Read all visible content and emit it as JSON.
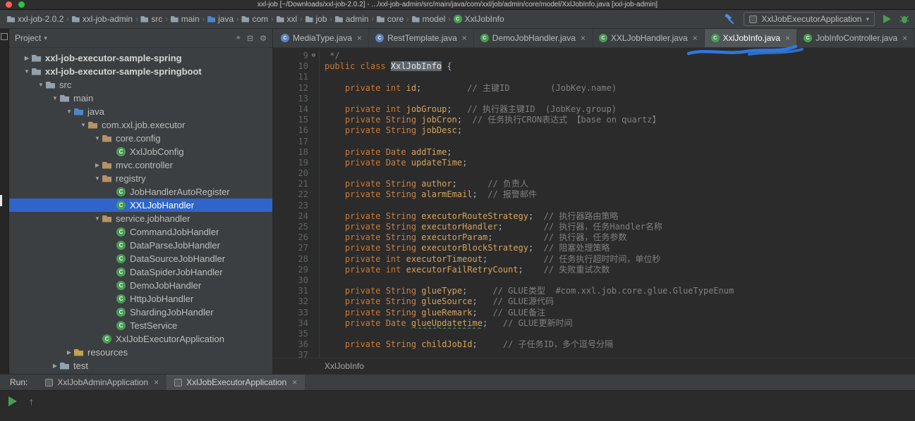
{
  "ui": {
    "chevron": "›",
    "caret": "▾",
    "close": "×",
    "fold": "⊖",
    "arrow_open": "▼",
    "arrow_closed": "▶",
    "up_arrow": "↑"
  },
  "colors": {
    "selection_blue": "#2f65ca",
    "annotation_blue": "#2f7ef0",
    "run_green": "#499C54",
    "keyword_orange": "#cc7832"
  },
  "title_bar": {
    "title": "xxl-job [~/Downloads/xxl-job-2.0.2] - .../xxl-job-admin/src/main/java/com/xxl/job/admin/core/model/XxlJobInfo.java [xxl-job-admin]",
    "lights": [
      {
        "name": "close",
        "color": "#ff5f57"
      },
      {
        "name": "zoom",
        "color": "#28c840"
      }
    ]
  },
  "navbar": {
    "breadcrumbs": [
      {
        "label": "xxl-job-2.0.2",
        "icon": "module"
      },
      {
        "label": "xxl-job-admin",
        "icon": "module"
      },
      {
        "label": "src",
        "icon": "folder"
      },
      {
        "label": "main",
        "icon": "folder"
      },
      {
        "label": "java",
        "icon": "src"
      },
      {
        "label": "com",
        "icon": "folder"
      },
      {
        "label": "xxl",
        "icon": "folder"
      },
      {
        "label": "job",
        "icon": "folder"
      },
      {
        "label": "admin",
        "icon": "folder"
      },
      {
        "label": "core",
        "icon": "folder"
      },
      {
        "label": "model",
        "icon": "folder"
      },
      {
        "label": "XxlJobInfo",
        "icon": "class"
      }
    ],
    "run_config": {
      "label": "XxlJobExecutorApplication"
    }
  },
  "project_panel": {
    "title": "Project",
    "toolbar_icons": [
      {
        "name": "locate-icon",
        "glyph": "⌖"
      },
      {
        "name": "collapse-all-icon",
        "glyph": "⊟"
      },
      {
        "name": "settings-gear-icon",
        "glyph": "⚙"
      }
    ],
    "items": [
      {
        "label": "xxl-job-executor-sample-spring",
        "depth": 0,
        "arrow": "closed",
        "icon": "module",
        "bold": true
      },
      {
        "label": "xxl-job-executor-sample-springboot",
        "depth": 0,
        "arrow": "open",
        "icon": "module",
        "bold": true
      },
      {
        "label": "src",
        "depth": 1,
        "arrow": "open",
        "icon": "folder"
      },
      {
        "label": "main",
        "depth": 2,
        "arrow": "open",
        "icon": "folder"
      },
      {
        "label": "java",
        "depth": 3,
        "arrow": "open",
        "icon": "src"
      },
      {
        "label": "com.xxl.job.executor",
        "depth": 4,
        "arrow": "open",
        "icon": "pkg"
      },
      {
        "label": "core.config",
        "depth": 5,
        "arrow": "open",
        "icon": "pkg"
      },
      {
        "label": "XxlJobConfig",
        "depth": 6,
        "arrow": "none",
        "icon": "class"
      },
      {
        "label": "mvc.controller",
        "depth": 5,
        "arrow": "closed",
        "icon": "pkg"
      },
      {
        "label": "registry",
        "depth": 5,
        "arrow": "open",
        "icon": "pkg"
      },
      {
        "label": "JobHandlerAutoRegister",
        "depth": 6,
        "arrow": "none",
        "icon": "class"
      },
      {
        "label": "XXLJobHandler",
        "depth": 6,
        "arrow": "none",
        "icon": "class",
        "selected": true
      },
      {
        "label": "service.jobhandler",
        "depth": 5,
        "arrow": "open",
        "icon": "pkg"
      },
      {
        "label": "CommandJobHandler",
        "depth": 6,
        "arrow": "none",
        "icon": "class"
      },
      {
        "label": "DataParseJobHandler",
        "depth": 6,
        "arrow": "none",
        "icon": "class"
      },
      {
        "label": "DataSourceJobHandler",
        "depth": 6,
        "arrow": "none",
        "icon": "class"
      },
      {
        "label": "DataSpiderJobHandler",
        "depth": 6,
        "arrow": "none",
        "icon": "class"
      },
      {
        "label": "DemoJobHandler",
        "depth": 6,
        "arrow": "none",
        "icon": "class"
      },
      {
        "label": "HttpJobHandler",
        "depth": 6,
        "arrow": "none",
        "icon": "class"
      },
      {
        "label": "ShardingJobHandler",
        "depth": 6,
        "arrow": "none",
        "icon": "class"
      },
      {
        "label": "TestService",
        "depth": 6,
        "arrow": "none",
        "icon": "class"
      },
      {
        "label": "XxlJobExecutorApplication",
        "depth": 5,
        "arrow": "none",
        "icon": "class"
      },
      {
        "label": "resources",
        "depth": 3,
        "arrow": "closed",
        "icon": "res"
      },
      {
        "label": "test",
        "depth": 2,
        "arrow": "closed",
        "icon": "folder"
      }
    ]
  },
  "editor": {
    "tabs": [
      {
        "label": "MediaType.java",
        "active": false,
        "icon_color": "#5f82c4"
      },
      {
        "label": "RestTemplate.java",
        "active": false,
        "icon_color": "#5f82c4"
      },
      {
        "label": "DemoJobHandler.java",
        "active": false,
        "icon_color": "#499C54"
      },
      {
        "label": "XXLJobHandler.java",
        "active": false,
        "icon_color": "#499C54"
      },
      {
        "label": "XxlJobInfo.java",
        "active": true,
        "icon_color": "#499C54"
      },
      {
        "label": "JobInfoController.java",
        "active": false,
        "icon_color": "#499C54"
      }
    ],
    "breadcrumb": "XxlJobInfo",
    "code": {
      "lines": [
        {
          "n": 9,
          "fold": true,
          "t": [
            [
              "com",
              " */"
            ]
          ]
        },
        {
          "n": 10,
          "t": [
            [
              "kw",
              "public class "
            ],
            [
              "cls",
              "XxlJobInfo"
            ],
            [
              "pln",
              " {"
            ]
          ]
        },
        {
          "n": 11,
          "t": []
        },
        {
          "n": 12,
          "t": [
            [
              "kw",
              "    private int "
            ],
            [
              "fld",
              "id"
            ],
            [
              "pln",
              ";"
            ],
            [
              "com",
              "         // 主键ID        (JobKey.name)"
            ]
          ]
        },
        {
          "n": 13,
          "t": []
        },
        {
          "n": 14,
          "t": [
            [
              "kw",
              "    private int "
            ],
            [
              "fld",
              "jobGroup"
            ],
            [
              "pln",
              ";"
            ],
            [
              "com",
              "   // 执行器主键ID  (JobKey.group)"
            ]
          ]
        },
        {
          "n": 15,
          "t": [
            [
              "kw",
              "    private "
            ],
            [
              "typ",
              "String "
            ],
            [
              "fld",
              "jobCron"
            ],
            [
              "pln",
              ";"
            ],
            [
              "com",
              "  // 任务执行CRON表达式 【base on quartz】"
            ]
          ]
        },
        {
          "n": 16,
          "t": [
            [
              "kw",
              "    private "
            ],
            [
              "typ",
              "String "
            ],
            [
              "fld",
              "jobDesc"
            ],
            [
              "pln",
              ";"
            ]
          ]
        },
        {
          "n": 17,
          "t": []
        },
        {
          "n": 18,
          "t": [
            [
              "kw",
              "    private "
            ],
            [
              "typ",
              "Date "
            ],
            [
              "fld",
              "addTime"
            ],
            [
              "pln",
              ";"
            ]
          ]
        },
        {
          "n": 19,
          "t": [
            [
              "kw",
              "    private "
            ],
            [
              "typ",
              "Date "
            ],
            [
              "fld",
              "updateTime"
            ],
            [
              "pln",
              ";"
            ]
          ]
        },
        {
          "n": 20,
          "t": []
        },
        {
          "n": 21,
          "t": [
            [
              "kw",
              "    private "
            ],
            [
              "typ",
              "String "
            ],
            [
              "fld",
              "author"
            ],
            [
              "pln",
              ";"
            ],
            [
              "com",
              "      // 负责人"
            ]
          ]
        },
        {
          "n": 22,
          "t": [
            [
              "kw",
              "    private "
            ],
            [
              "typ",
              "String "
            ],
            [
              "fld",
              "alarmEmail"
            ],
            [
              "pln",
              ";"
            ],
            [
              "com",
              "  // 报警邮件"
            ]
          ]
        },
        {
          "n": 23,
          "t": []
        },
        {
          "n": 24,
          "t": [
            [
              "kw",
              "    private "
            ],
            [
              "typ",
              "String "
            ],
            [
              "fld",
              "executorRouteStrategy"
            ],
            [
              "pln",
              ";"
            ],
            [
              "com",
              "  // 执行器路由策略"
            ]
          ]
        },
        {
          "n": 25,
          "t": [
            [
              "kw",
              "    private "
            ],
            [
              "typ",
              "String "
            ],
            [
              "fld",
              "executorHandler"
            ],
            [
              "pln",
              ";"
            ],
            [
              "com",
              "        // 执行器，任务Handler名称"
            ]
          ]
        },
        {
          "n": 26,
          "t": [
            [
              "kw",
              "    private "
            ],
            [
              "typ",
              "String "
            ],
            [
              "fld",
              "executorParam"
            ],
            [
              "pln",
              ";"
            ],
            [
              "com",
              "          // 执行器，任务参数"
            ]
          ]
        },
        {
          "n": 27,
          "t": [
            [
              "kw",
              "    private "
            ],
            [
              "typ",
              "String "
            ],
            [
              "fld",
              "executorBlockStrategy"
            ],
            [
              "pln",
              ";"
            ],
            [
              "com",
              "  // 阻塞处理策略"
            ]
          ]
        },
        {
          "n": 28,
          "t": [
            [
              "kw",
              "    private int "
            ],
            [
              "fld",
              "executorTimeout"
            ],
            [
              "pln",
              ";"
            ],
            [
              "com",
              "           // 任务执行超时时间，单位秒"
            ]
          ]
        },
        {
          "n": 29,
          "t": [
            [
              "kw",
              "    private int "
            ],
            [
              "fld",
              "executorFailRetryCount"
            ],
            [
              "pln",
              ";"
            ],
            [
              "com",
              "    // 失败重试次数"
            ]
          ]
        },
        {
          "n": 30,
          "t": []
        },
        {
          "n": 31,
          "t": [
            [
              "kw",
              "    private "
            ],
            [
              "typ",
              "String "
            ],
            [
              "fld",
              "glueType"
            ],
            [
              "pln",
              ";"
            ],
            [
              "com",
              "     // GLUE类型  #com.xxl.job.core.glue.GlueTypeEnum"
            ]
          ]
        },
        {
          "n": 32,
          "t": [
            [
              "kw",
              "    private "
            ],
            [
              "typ",
              "String "
            ],
            [
              "fld",
              "glueSource"
            ],
            [
              "pln",
              ";"
            ],
            [
              "com",
              "   // GLUE源代码"
            ]
          ]
        },
        {
          "n": 33,
          "t": [
            [
              "kw",
              "    private "
            ],
            [
              "typ",
              "String "
            ],
            [
              "fld",
              "glueRemark"
            ],
            [
              "pln",
              ";"
            ],
            [
              "com",
              "   // GLUE备注"
            ]
          ]
        },
        {
          "n": 34,
          "t": [
            [
              "kw",
              "    private "
            ],
            [
              "typ",
              "Date "
            ],
            [
              "fld_sp",
              "glueUpdatetime"
            ],
            [
              "pln",
              ";"
            ],
            [
              "com",
              "   // GLUE更新时间"
            ]
          ]
        },
        {
          "n": 35,
          "t": []
        },
        {
          "n": 36,
          "t": [
            [
              "kw",
              "    private "
            ],
            [
              "typ",
              "String "
            ],
            [
              "fld",
              "childJobId"
            ],
            [
              "pln",
              ";"
            ],
            [
              "com",
              "     // 子任务ID，多个逗号分隔"
            ]
          ]
        },
        {
          "n": 37,
          "t": []
        }
      ]
    }
  },
  "run_panel": {
    "label": "Run:",
    "tabs": [
      {
        "label": "XxlJobAdminApplication",
        "active": false
      },
      {
        "label": "XxlJobExecutorApplication",
        "active": true
      }
    ]
  }
}
